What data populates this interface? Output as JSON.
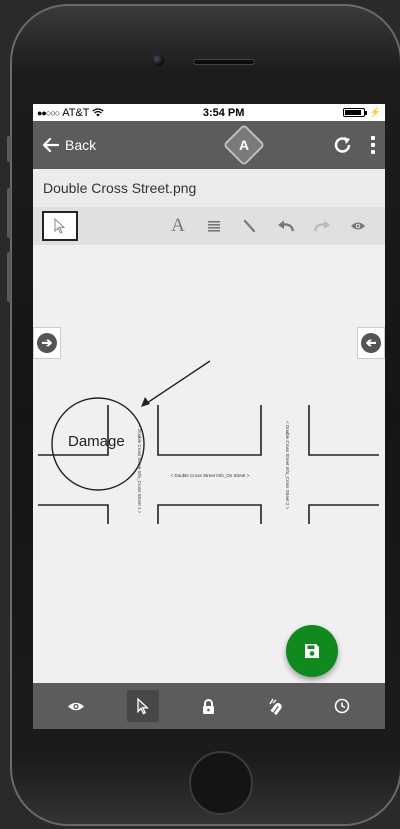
{
  "status_bar": {
    "carrier_signal": "●●○○○",
    "carrier": "AT&T",
    "time": "3:54 PM",
    "battery_level": 0.9
  },
  "nav": {
    "back_label": "Back",
    "logo_letter": "A",
    "icons": [
      "arrow-left-icon",
      "app-logo-icon",
      "refresh-icon",
      "kebab-menu-icon"
    ]
  },
  "file": {
    "name": "Double Cross Street.png"
  },
  "toolbar": {
    "tools": [
      "select-pointer-icon",
      "text-icon",
      "lines-icon",
      "pen-icon",
      "undo-icon",
      "redo-icon",
      "eye-icon"
    ],
    "text_tool_glyph": "A"
  },
  "canvas": {
    "annotation_text": "Damage",
    "street_label_1": "< Double Cross Street Info_Cross Street 1 >",
    "street_label_on": "< Double Cross Street Info_On Street >",
    "street_label_2": "< Double Cross Street Info_Cross Street 2 >"
  },
  "fab": {
    "icon": "save-icon",
    "color": "#108a1e"
  },
  "bottom_bar": {
    "items": [
      "eye-icon",
      "pointer-icon",
      "lock-icon",
      "magnet-icon",
      "clock-icon"
    ],
    "active_index": 1
  },
  "colors": {
    "nav_bg": "#5c5c5c",
    "canvas_bg": "#f0f0f0",
    "fab_green": "#108a1e"
  }
}
